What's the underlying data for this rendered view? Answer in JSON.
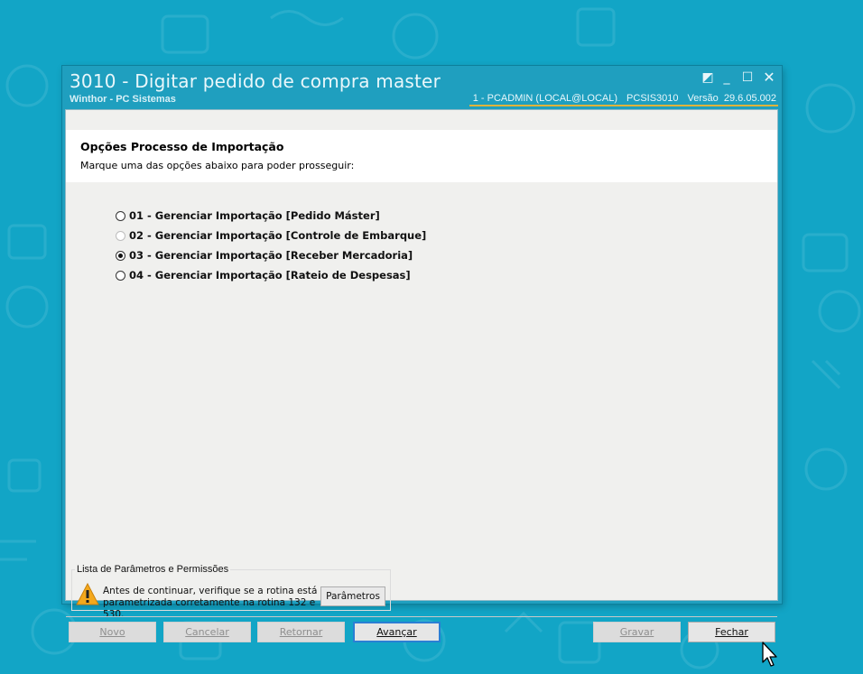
{
  "window": {
    "title": "3010 - Digitar pedido de compra master",
    "subtitle": "Winthor - PC Sistemas",
    "status": {
      "connection": "1 - PCADMIN (LOCAL@LOCAL)",
      "module": "PCSIS3010",
      "version": "Versão  29.6.05.002"
    },
    "controls": [
      "restore-icon",
      "minimize-icon",
      "maximize-icon",
      "close-icon"
    ]
  },
  "header": {
    "title": "Opções Processo de Importação",
    "description": "Marque uma das opções abaixo para poder prosseguir:"
  },
  "options": [
    {
      "label": "01 - Gerenciar Importação [Pedido Máster]",
      "checked": false,
      "enabled": true
    },
    {
      "label": "02 - Gerenciar Importação [Controle de Embarque]",
      "checked": false,
      "enabled": false
    },
    {
      "label": "03 - Gerenciar Importação [Receber Mercadoria]",
      "checked": true,
      "enabled": true
    },
    {
      "label": "04 - Gerenciar Importação [Rateio de Despesas]",
      "checked": false,
      "enabled": true
    }
  ],
  "params": {
    "legend": "Lista de Parâmetros e Permissões",
    "warning_line1": "Antes de continuar, verifique se a rotina está",
    "warning_line2": "parametrizada corretamente na rotina 132 e 530.",
    "button": "Parâmetros",
    "icon": "warning-icon"
  },
  "footer": {
    "novo": "Novo",
    "cancelar": "Cancelar",
    "retornar": "Retornar",
    "avancar": "Avançar",
    "gravar": "Gravar",
    "fechar": "Fechar"
  },
  "colors": {
    "desktop": "#12a5c6",
    "accent_underline": "#e0b33a",
    "default_button_border": "#2a7fd4"
  }
}
